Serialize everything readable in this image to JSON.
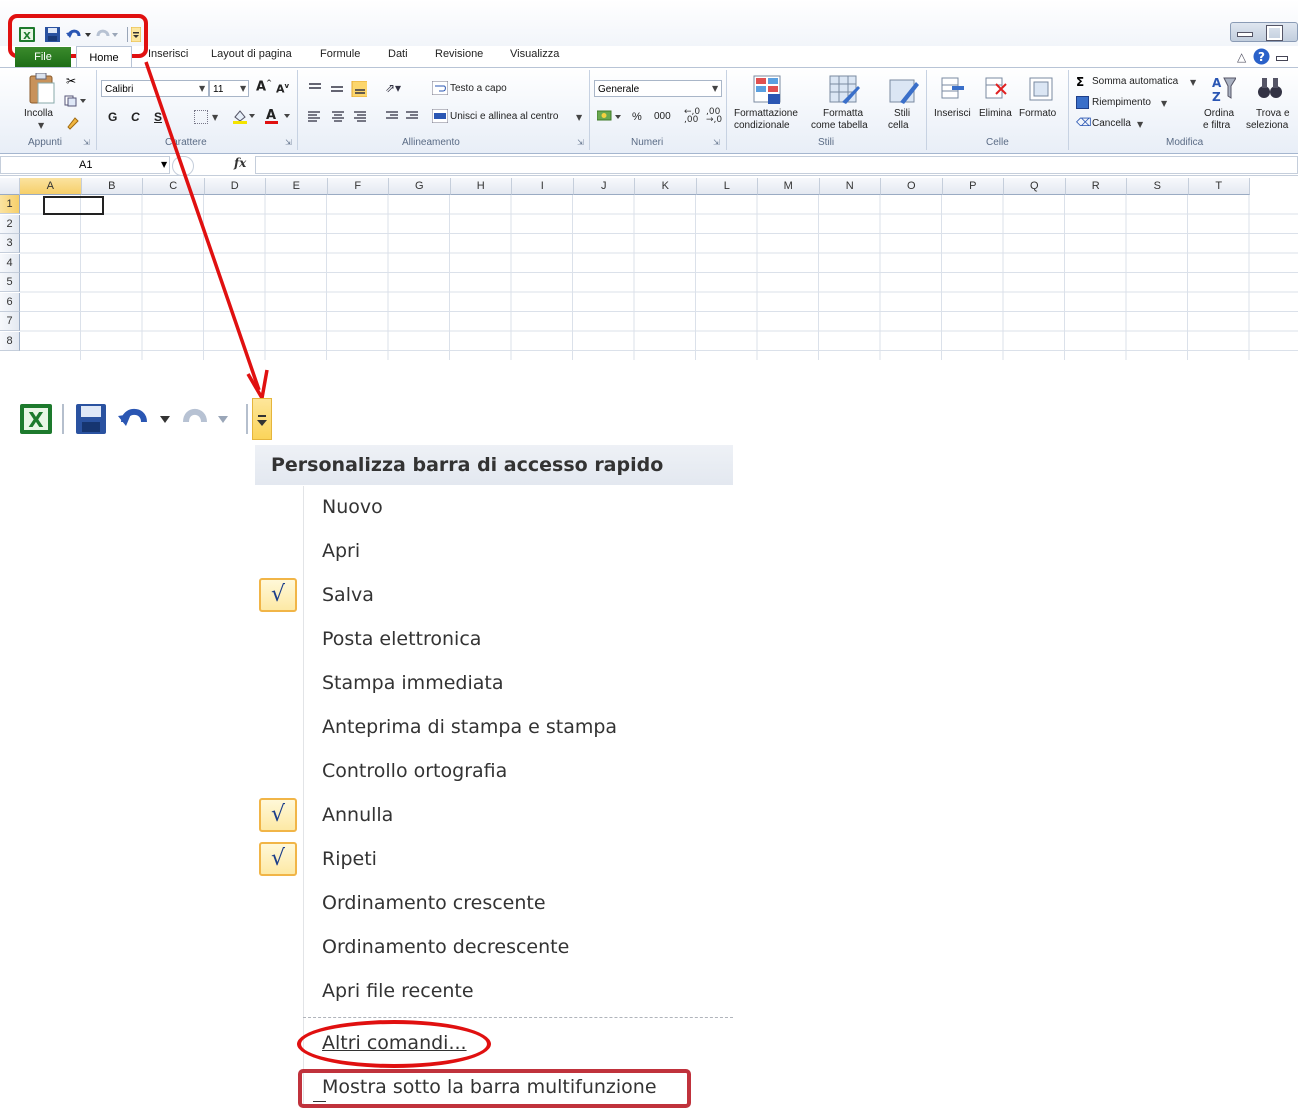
{
  "excel": {
    "tabs": {
      "file": "File",
      "home": "Home",
      "insert": "Inserisci",
      "page_layout": "Layout di pagina",
      "formulas": "Formule",
      "data": "Dati",
      "review": "Revisione",
      "view": "Visualizza"
    },
    "ribbon": {
      "paste_label": "Incolla",
      "font_name": "Calibri",
      "font_size": "11",
      "bold": "G",
      "italic": "C",
      "underline": "S",
      "wrap_text": "Testo a capo",
      "merge_center": "Unisci e allinea al centro",
      "number_format": "Generale",
      "percent": "%",
      "thousands": "000",
      "conditional_format_1": "Formattazione",
      "conditional_format_2": "condizionale",
      "format_table_1": "Formatta",
      "format_table_2": "come tabella",
      "cell_styles_1": "Stili",
      "cell_styles_2": "cella",
      "insert_cells": "Inserisci",
      "delete_cells": "Elimina",
      "format_cells": "Formato",
      "autosum": "Somma automatica",
      "fill": "Riempimento",
      "clear": "Cancella",
      "sort_1": "Ordina",
      "sort_2": "e filtra",
      "find_1": "Trova e",
      "find_2": "seleziona",
      "groups": {
        "clipboard": "Appunti",
        "font": "Carattere",
        "alignment": "Allineamento",
        "number": "Numeri",
        "styles": "Stili",
        "cells": "Celle",
        "editing": "Modifica"
      }
    },
    "name_box": "A1",
    "fx": "fx",
    "columns": [
      "A",
      "B",
      "C",
      "D",
      "E",
      "F",
      "G",
      "H",
      "I",
      "J",
      "K",
      "L",
      "M",
      "N",
      "O",
      "P",
      "Q",
      "R",
      "S",
      "T"
    ],
    "rows": [
      "1",
      "2",
      "3",
      "4",
      "5",
      "6",
      "7",
      "8"
    ]
  },
  "menu": {
    "title": "Personalizza barra di accesso rapido",
    "items": [
      {
        "label": "Nuovo",
        "checked": false
      },
      {
        "label": "Apri",
        "checked": false
      },
      {
        "label": "Salva",
        "checked": true
      },
      {
        "label": "Posta elettronica",
        "checked": false
      },
      {
        "label": "Stampa immediata",
        "checked": false
      },
      {
        "label": "Anteprima di stampa e stampa",
        "checked": false
      },
      {
        "label": "Controllo ortografia",
        "checked": false
      },
      {
        "label": "Annulla",
        "checked": true
      },
      {
        "label": "Ripeti",
        "checked": true
      },
      {
        "label": "Ordinamento crescente",
        "checked": false
      },
      {
        "label": "Ordinamento decrescente",
        "checked": false
      },
      {
        "label": "Apri file recente",
        "checked": false
      }
    ],
    "more_commands": "Altri comandi...",
    "show_below_ribbon": "Mostra sotto la barra multifunzione",
    "check_glyph": "√"
  },
  "colors": {
    "annotation_red": "#e01010",
    "file_tab_green": "#2a7d22",
    "check_border": "#f1b547"
  }
}
